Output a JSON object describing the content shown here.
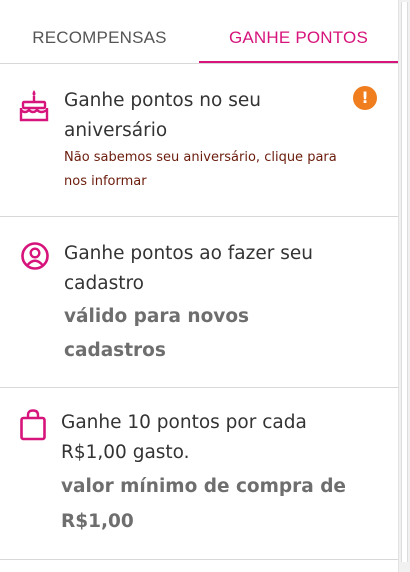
{
  "tabs": [
    {
      "label": "RECOMPENSAS",
      "active": false
    },
    {
      "label": "GANHE PONTOS",
      "active": true
    }
  ],
  "colors": {
    "accent": "#d6147b",
    "alert": "#f07d1e",
    "hint_text": "#6b1c0c"
  },
  "cards": [
    {
      "icon": "birthday-cake-icon",
      "title_line1": "Ganhe pontos no seu",
      "title_line2": "aniversário",
      "subtitle_line1": "Não sabemos seu aniversário, clique para",
      "subtitle_line2": "nos informar",
      "alert_icon": "exclamation-icon",
      "alert_symbol": "!"
    },
    {
      "icon": "user-circle-icon",
      "title_line1": "Ganhe pontos ao fazer seu",
      "title_line2": "cadastro",
      "subtitle_line1": "válido para novos",
      "subtitle_line2": "cadastros"
    },
    {
      "icon": "shopping-bag-icon",
      "title_line1": "Ganhe 10 pontos por cada",
      "title_line2": "R$1,00 gasto.",
      "subtitle_line1": "valor mínimo de compra de",
      "subtitle_line2": "R$1,00"
    }
  ]
}
